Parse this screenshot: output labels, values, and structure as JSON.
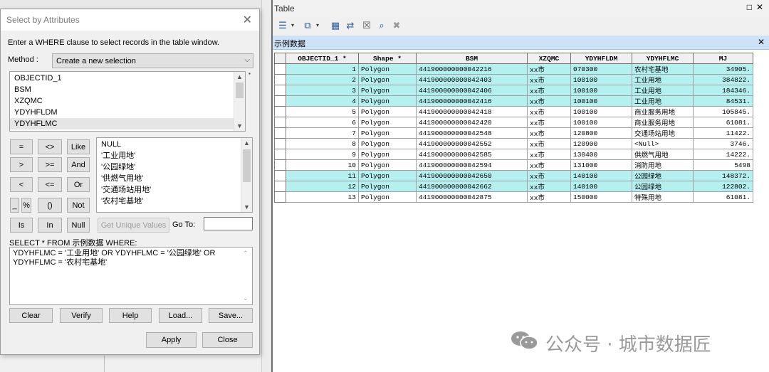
{
  "dialog": {
    "title": "Select by Attributes",
    "instructions": "Enter a WHERE clause to select records in the table window.",
    "method_label": "Method :",
    "method_value": "Create a new selection",
    "fields": [
      "OBJECTID_1",
      "BSM",
      "XZQMC",
      "YDYHFLDM",
      "YDYHFLMC"
    ],
    "selected_field": "YDYHFLMC",
    "operators": {
      "eq": "=",
      "ne": "<>",
      "like": "Like",
      "gt": ">",
      "ge": ">=",
      "and": "And",
      "lt": "<",
      "le": "<=",
      "or": "Or",
      "underscore": "_",
      "percent": "%",
      "parens": "()",
      "not": "Not",
      "is": "Is",
      "in": "In",
      "null": "Null"
    },
    "values": [
      "NULL",
      "'工业用地'",
      "'公园绿地'",
      "'供燃气用地'",
      "'交通场站用地'",
      "'农村宅基地'"
    ],
    "get_unique_values": "Get Unique Values",
    "goto_label": "Go To:",
    "goto_value": "",
    "sql_prefix": "SELECT * FROM 示例数据 WHERE:",
    "sql_line1": "YDYHFLMC = '工业用地' OR YDYHFLMC = '公园绿地' OR",
    "sql_line2": "YDYHFLMC = '农村宅基地'",
    "buttons": {
      "clear": "Clear",
      "verify": "Verify",
      "help": "Help",
      "load": "Load...",
      "save": "Save...",
      "apply": "Apply",
      "close": "Close"
    }
  },
  "table_window": {
    "title": "Table",
    "tab": "示例数据",
    "columns": [
      "OBJECTID_1 *",
      "Shape *",
      "BSM",
      "XZQMC",
      "YDYHFLDM",
      "YDYHFLMC",
      "MJ"
    ],
    "rows": [
      {
        "id": "1",
        "shape": "Polygon",
        "bsm": "441900000000042216",
        "xzqmc": "xx市",
        "dm": "070300",
        "mc": "农村宅基地",
        "mj": "34905.",
        "selected": true
      },
      {
        "id": "2",
        "shape": "Polygon",
        "bsm": "441900000000042403",
        "xzqmc": "xx市",
        "dm": "100100",
        "mc": "工业用地",
        "mj": "384822.",
        "selected": true
      },
      {
        "id": "3",
        "shape": "Polygon",
        "bsm": "441900000000042406",
        "xzqmc": "xx市",
        "dm": "100100",
        "mc": "工业用地",
        "mj": "184346.",
        "selected": true
      },
      {
        "id": "4",
        "shape": "Polygon",
        "bsm": "441900000000042416",
        "xzqmc": "xx市",
        "dm": "100100",
        "mc": "工业用地",
        "mj": "84531.",
        "selected": true
      },
      {
        "id": "5",
        "shape": "Polygon",
        "bsm": "441900000000042418",
        "xzqmc": "xx市",
        "dm": "100100",
        "mc": "商业服务用地",
        "mj": "105845.",
        "selected": false
      },
      {
        "id": "6",
        "shape": "Polygon",
        "bsm": "441900000000042420",
        "xzqmc": "xx市",
        "dm": "100100",
        "mc": "商业服务用地",
        "mj": "61081.",
        "selected": false
      },
      {
        "id": "7",
        "shape": "Polygon",
        "bsm": "441900000000042548",
        "xzqmc": "xx市",
        "dm": "120800",
        "mc": "交通场站用地",
        "mj": "11422.",
        "selected": false
      },
      {
        "id": "8",
        "shape": "Polygon",
        "bsm": "441900000000042552",
        "xzqmc": "xx市",
        "dm": "120900",
        "mc": "<Null>",
        "mj": "3746.",
        "selected": false
      },
      {
        "id": "9",
        "shape": "Polygon",
        "bsm": "441900000000042585",
        "xzqmc": "xx市",
        "dm": "130400",
        "mc": "供燃气用地",
        "mj": "14222.",
        "selected": false
      },
      {
        "id": "10",
        "shape": "Polygon",
        "bsm": "441900000000042594",
        "xzqmc": "xx市",
        "dm": "131000",
        "mc": "消防用地",
        "mj": "5498",
        "selected": false
      },
      {
        "id": "11",
        "shape": "Polygon",
        "bsm": "441900000000042650",
        "xzqmc": "xx市",
        "dm": "140100",
        "mc": "公园绿地",
        "mj": "148372.",
        "selected": true
      },
      {
        "id": "12",
        "shape": "Polygon",
        "bsm": "441900000000042662",
        "xzqmc": "xx市",
        "dm": "140100",
        "mc": "公园绿地",
        "mj": "122802.",
        "selected": true
      },
      {
        "id": "13",
        "shape": "Polygon",
        "bsm": "441900000000042875",
        "xzqmc": "xx市",
        "dm": "150000",
        "mc": "特殊用地",
        "mj": "61081.",
        "selected": false
      }
    ]
  },
  "watermark": "公众号 · 城市数据匠",
  "colors": {
    "selected_row": "#b5f0f0",
    "tab_bar": "#cde1f7"
  }
}
